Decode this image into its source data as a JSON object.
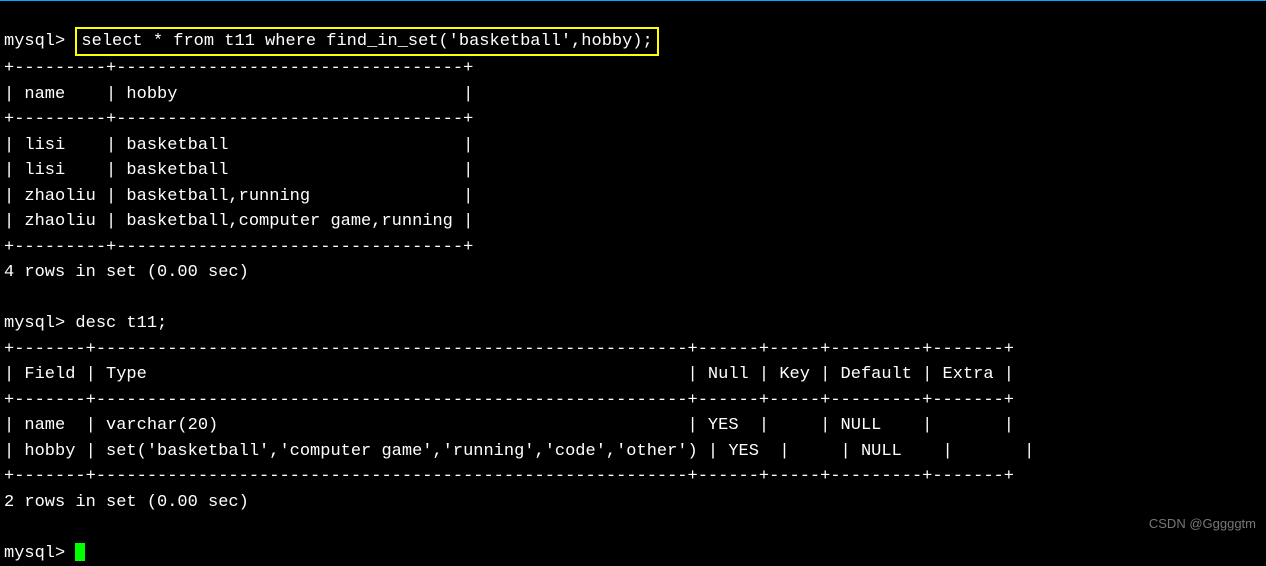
{
  "prompt": "mysql>",
  "query1": {
    "command": "select * from t11 where find_in_set('basketball',hobby);",
    "border_top": "+---------+----------------------------------+",
    "header": "| name    | hobby                            |",
    "border_mid": "+---------+----------------------------------+",
    "rows": [
      "| lisi    | basketball                       |",
      "| lisi    | basketball                       |",
      "| zhaoliu | basketball,running               |",
      "| zhaoliu | basketball,computer game,running |"
    ],
    "border_bot": "+---------+----------------------------------+",
    "status": "4 rows in set (0.00 sec)"
  },
  "query2": {
    "command": "desc t11;",
    "border_top": "+-------+----------------------------------------------------------+------+-----+---------+-------+",
    "header": "| Field | Type                                                     | Null | Key | Default | Extra |",
    "border_mid": "+-------+----------------------------------------------------------+------+-----+---------+-------+",
    "rows": [
      "| name  | varchar(20)                                              | YES  |     | NULL    |       |",
      "| hobby | set('basketball','computer game','running','code','other') | YES  |     | NULL    |       |"
    ],
    "border_bot": "+-------+----------------------------------------------------------+------+-----+---------+-------+",
    "status": "2 rows in set (0.00 sec)"
  },
  "watermark": "CSDN @Gggggtm"
}
